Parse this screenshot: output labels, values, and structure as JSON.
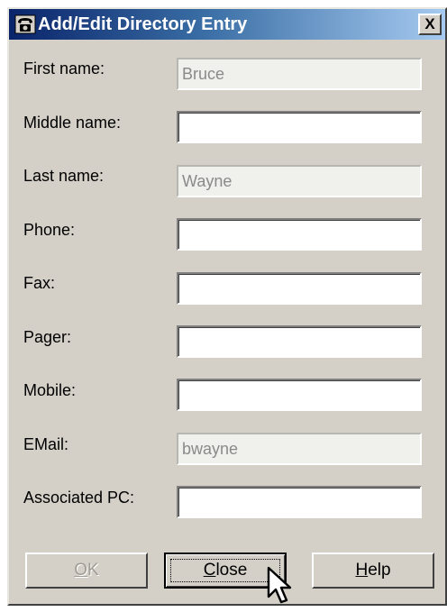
{
  "window": {
    "title": "Add/Edit Directory Entry",
    "close_label": "X",
    "icon": "telephone-icon"
  },
  "fields": [
    {
      "label": "First name:",
      "value": "Bruce",
      "enabled": false
    },
    {
      "label": "Middle name:",
      "value": "",
      "enabled": true
    },
    {
      "label": "Last name:",
      "value": "Wayne",
      "enabled": false
    },
    {
      "label": "Phone:",
      "value": "",
      "enabled": true
    },
    {
      "label": "Fax:",
      "value": "",
      "enabled": true
    },
    {
      "label": "Pager:",
      "value": "",
      "enabled": true
    },
    {
      "label": "Mobile:",
      "value": "",
      "enabled": true
    },
    {
      "label": "EMail:",
      "value": "bwayne",
      "enabled": false
    },
    {
      "label": "Associated PC:",
      "value": "",
      "enabled": true
    }
  ],
  "buttons": {
    "ok": {
      "label_access": "O",
      "label_rest": "K",
      "enabled": false
    },
    "close": {
      "label_access": "C",
      "label_rest": "lose",
      "enabled": true,
      "default": true
    },
    "help": {
      "label_access": "H",
      "label_rest": "elp",
      "enabled": true
    }
  },
  "colors": {
    "title_gradient_start": "#0a246a",
    "title_gradient_end": "#a6caf0",
    "dialog_face": "#d4d0c8"
  }
}
